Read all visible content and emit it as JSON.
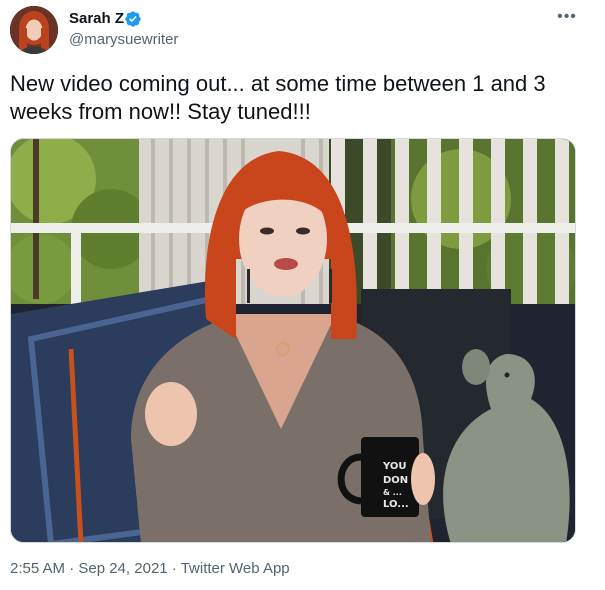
{
  "author": {
    "display_name": "Sarah Z",
    "handle": "@marysuewriter",
    "verified": true
  },
  "actions": {
    "more_icon": "more-icon",
    "more_glyph": "•••"
  },
  "tweet": {
    "text": "New video coming out... at some time between 1 and 3 weeks from now!! Stay tuned!!!"
  },
  "media": {
    "mug_text": [
      "YOU",
      "DON",
      "& ...",
      "LO..."
    ]
  },
  "meta": {
    "time": "2:55 AM",
    "separator": " · ",
    "date": "Sep 24, 2021",
    "source": "Twitter Web App"
  },
  "colors": {
    "verified_badge": "#1d9bf0",
    "secondary_text": "#536471",
    "primary_text": "#0f1419"
  }
}
